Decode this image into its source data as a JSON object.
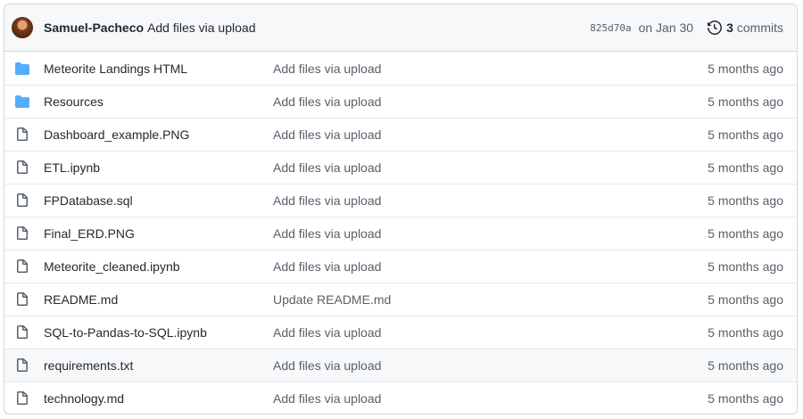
{
  "latest_commit": {
    "author": "Samuel-Pacheco",
    "message": "Add files via upload",
    "sha": "825d70a",
    "date": "on Jan 30",
    "commit_count": "3",
    "commit_label": "commits"
  },
  "files": [
    {
      "type": "folder",
      "name": "Meteorite Landings HTML",
      "message": "Add files via upload",
      "age": "5 months ago"
    },
    {
      "type": "folder",
      "name": "Resources",
      "message": "Add files via upload",
      "age": "5 months ago"
    },
    {
      "type": "file",
      "name": "Dashboard_example.PNG",
      "message": "Add files via upload",
      "age": "5 months ago"
    },
    {
      "type": "file",
      "name": "ETL.ipynb",
      "message": "Add files via upload",
      "age": "5 months ago"
    },
    {
      "type": "file",
      "name": "FPDatabase.sql",
      "message": "Add files via upload",
      "age": "5 months ago"
    },
    {
      "type": "file",
      "name": "Final_ERD.PNG",
      "message": "Add files via upload",
      "age": "5 months ago"
    },
    {
      "type": "file",
      "name": "Meteorite_cleaned.ipynb",
      "message": "Add files via upload",
      "age": "5 months ago"
    },
    {
      "type": "file",
      "name": "README.md",
      "message": "Update README.md",
      "age": "5 months ago"
    },
    {
      "type": "file",
      "name": "SQL-to-Pandas-to-SQL.ipynb",
      "message": "Add files via upload",
      "age": "5 months ago"
    },
    {
      "type": "file",
      "name": "requirements.txt",
      "message": "Add files via upload",
      "age": "5 months ago"
    },
    {
      "type": "file",
      "name": "technology.md",
      "message": "Add files via upload",
      "age": "5 months ago"
    }
  ],
  "colors": {
    "folder_icon": "#54aeff",
    "file_icon": "#57606a"
  }
}
